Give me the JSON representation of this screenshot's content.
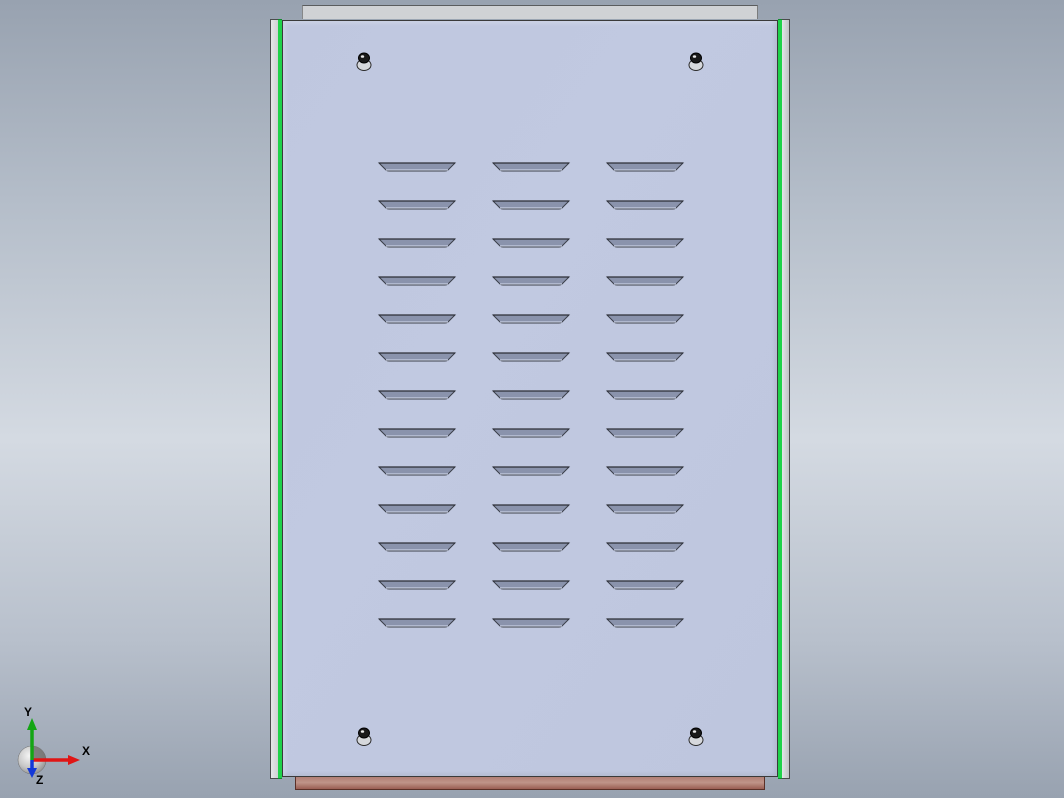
{
  "model": {
    "vent_rows": 13,
    "vent_cols": 3,
    "screw_positions": [
      "top-left",
      "top-right",
      "bottom-left",
      "bottom-right"
    ]
  },
  "colors": {
    "panel_face": "#c1c9e1",
    "edge_highlight": "#1fd24a",
    "base_plate": "#bf9489",
    "frame": "#cfd1d4"
  },
  "triad": {
    "x_label": "X",
    "y_label": "Y",
    "z_label": "Z",
    "x_color": "#e01515",
    "y_color": "#14a514",
    "z_color": "#1338d8"
  }
}
